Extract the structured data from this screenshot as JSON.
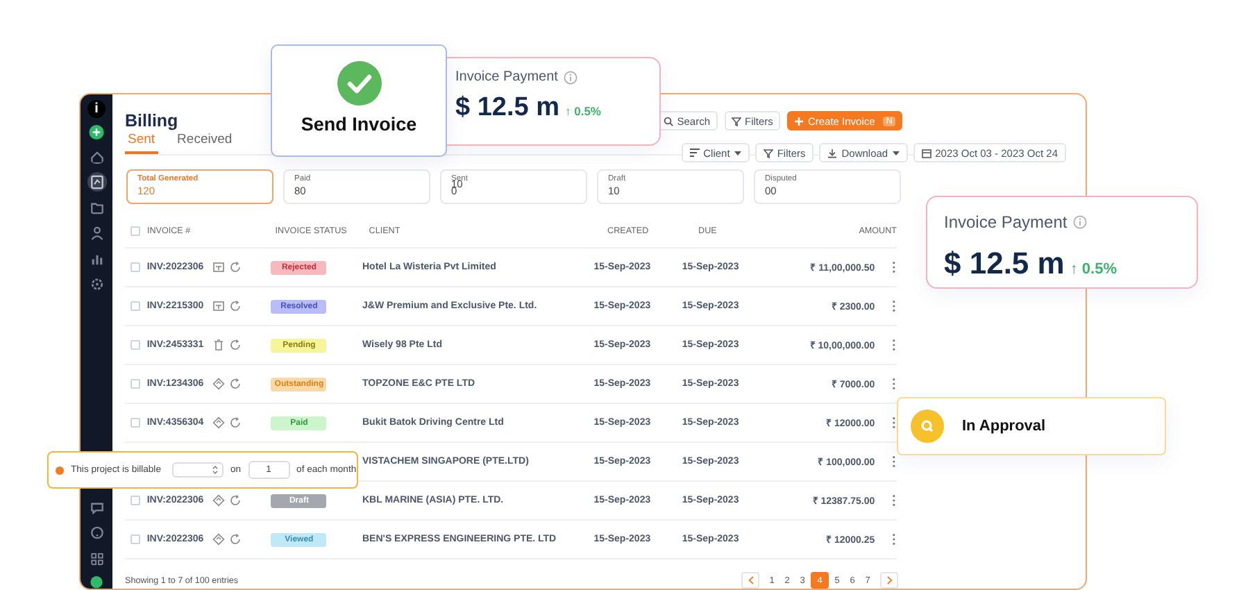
{
  "sidebar": {
    "logo": "i",
    "items": [
      {
        "kind": "home",
        "selected": false
      },
      {
        "kind": "report",
        "selected": true
      },
      {
        "kind": "folder",
        "selected": false
      },
      {
        "kind": "user",
        "selected": false
      },
      {
        "kind": "chart",
        "selected": false
      },
      {
        "kind": "gear",
        "selected": false
      }
    ],
    "bottom_items": [
      {
        "kind": "chat",
        "selected": false
      },
      {
        "kind": "help",
        "selected": false
      },
      {
        "kind": "grid",
        "selected": false
      }
    ]
  },
  "page_title": "Billing",
  "tabs": [
    {
      "label": "Sent",
      "selected": true
    },
    {
      "label": "Received",
      "selected": false
    }
  ],
  "header_tools": [
    {
      "kind": "search",
      "label": "Search"
    },
    {
      "kind": "filter",
      "label": "Filters"
    },
    {
      "kind": "create",
      "label": "Create Invoice",
      "shortcut": "N"
    }
  ],
  "toolbar": [
    {
      "kind": "sort",
      "label": "Client"
    },
    {
      "kind": "filter",
      "label": "Filters"
    },
    {
      "kind": "download",
      "label": "Download"
    },
    {
      "kind": "date",
      "label": "2023 Oct 03 - 2023 Oct 24"
    }
  ],
  "summary": [
    {
      "label": "Total Generated",
      "value": "120",
      "selected": true
    },
    {
      "label": "Paid",
      "value": "80",
      "selected": false
    },
    {
      "label": "Sent",
      "overlap": "10",
      "value": "0",
      "selected": false
    },
    {
      "label": "Draft",
      "value": "10",
      "selected": false
    },
    {
      "label": "Disputed",
      "value": "00",
      "selected": false
    }
  ],
  "table": {
    "all_checked": false,
    "columns": [
      "INVOICE #",
      "INVOICE STATUS",
      "CLIENT",
      "CREATED",
      "DUE",
      "AMOUNT"
    ],
    "rows": [
      {
        "checked": false,
        "invoice": "INV:2022306",
        "kind": "doc",
        "status": {
          "label": "Rejected",
          "kind": "rejected"
        },
        "client": "Hotel La Wisteria Pvt Limited",
        "created": "15-Sep-2023",
        "due": "15-Sep-2023",
        "amount": "₹ 11,00,000.50"
      },
      {
        "checked": false,
        "invoice": "INV:2215300",
        "kind": "doc",
        "status": {
          "label": "Resolved",
          "kind": "resolved"
        },
        "client": "J&W Premium and Exclusive Pte. Ltd.",
        "created": "15-Sep-2023",
        "due": "15-Sep-2023",
        "amount": "₹ 2300.00"
      },
      {
        "checked": false,
        "invoice": "INV:2453331",
        "kind": "trash",
        "status": {
          "label": "Pending",
          "kind": "pending"
        },
        "client": "Wisely 98 Pte Ltd",
        "created": "15-Sep-2023",
        "due": "15-Sep-2023",
        "amount": "₹ 10,00,000.00"
      },
      {
        "checked": false,
        "invoice": "INV:1234306",
        "kind": "diamond",
        "status": {
          "label": "Outstanding",
          "kind": "outstanding"
        },
        "client": "TOPZONE E&C PTE LTD",
        "created": "15-Sep-2023",
        "due": "15-Sep-2023",
        "amount": "₹ 7000.00"
      },
      {
        "checked": false,
        "invoice": "INV:4356304",
        "kind": "diamond",
        "status": {
          "label": "Paid",
          "kind": "paid"
        },
        "client": "Bukit Batok Driving Centre Ltd",
        "created": "15-Sep-2023",
        "due": "15-Sep-2023",
        "amount": "₹ 12000.00"
      },
      {
        "client": "VISTACHEM SINGAPORE (PTE.LTD)",
        "created": "15-Sep-2023",
        "due": "15-Sep-2023",
        "amount": "₹ 100,000.00"
      },
      {
        "checked": false,
        "invoice": "INV:2022306",
        "kind": "diamond",
        "status": {
          "label": "Draft",
          "kind": "draft"
        },
        "client": "KBL MARINE (ASIA) PTE. LTD.",
        "created": "15-Sep-2023",
        "due": "15-Sep-2023",
        "amount": "₹ 12387.75.00"
      },
      {
        "checked": false,
        "invoice": "INV:2022306",
        "kind": "diamond",
        "status": {
          "label": "Viewed",
          "kind": "viewed"
        },
        "client": "BEN'S EXPRESS ENGINEERING PTE. LTD",
        "created": "15-Sep-2023",
        "due": "15-Sep-2023",
        "amount": "₹ 12000.25"
      }
    ]
  },
  "footer": {
    "entries": "Showing 1 to 7 of 100 entries",
    "pages": [
      {
        "label": "1",
        "selected": false
      },
      {
        "label": "2",
        "selected": false
      },
      {
        "label": "3",
        "selected": false
      },
      {
        "label": "4",
        "selected": true
      },
      {
        "label": "5",
        "selected": false
      },
      {
        "label": "6",
        "selected": false
      },
      {
        "label": "7",
        "selected": false
      }
    ]
  },
  "send_card": {
    "title": "Send Invoice"
  },
  "payment_cards": [
    {
      "title": "Invoice Payment",
      "amount": "$ 12.5 m",
      "change": "↑ 0.5%"
    },
    {
      "title": "Invoice Payment",
      "amount": "$ 12.5 m",
      "change": "↑ 0.5%"
    }
  ],
  "approval_card": {
    "title": "In Approval"
  },
  "billable_popover": {
    "label": "This project is billable",
    "on": "on",
    "day": "1",
    "suffix": "of each month"
  }
}
